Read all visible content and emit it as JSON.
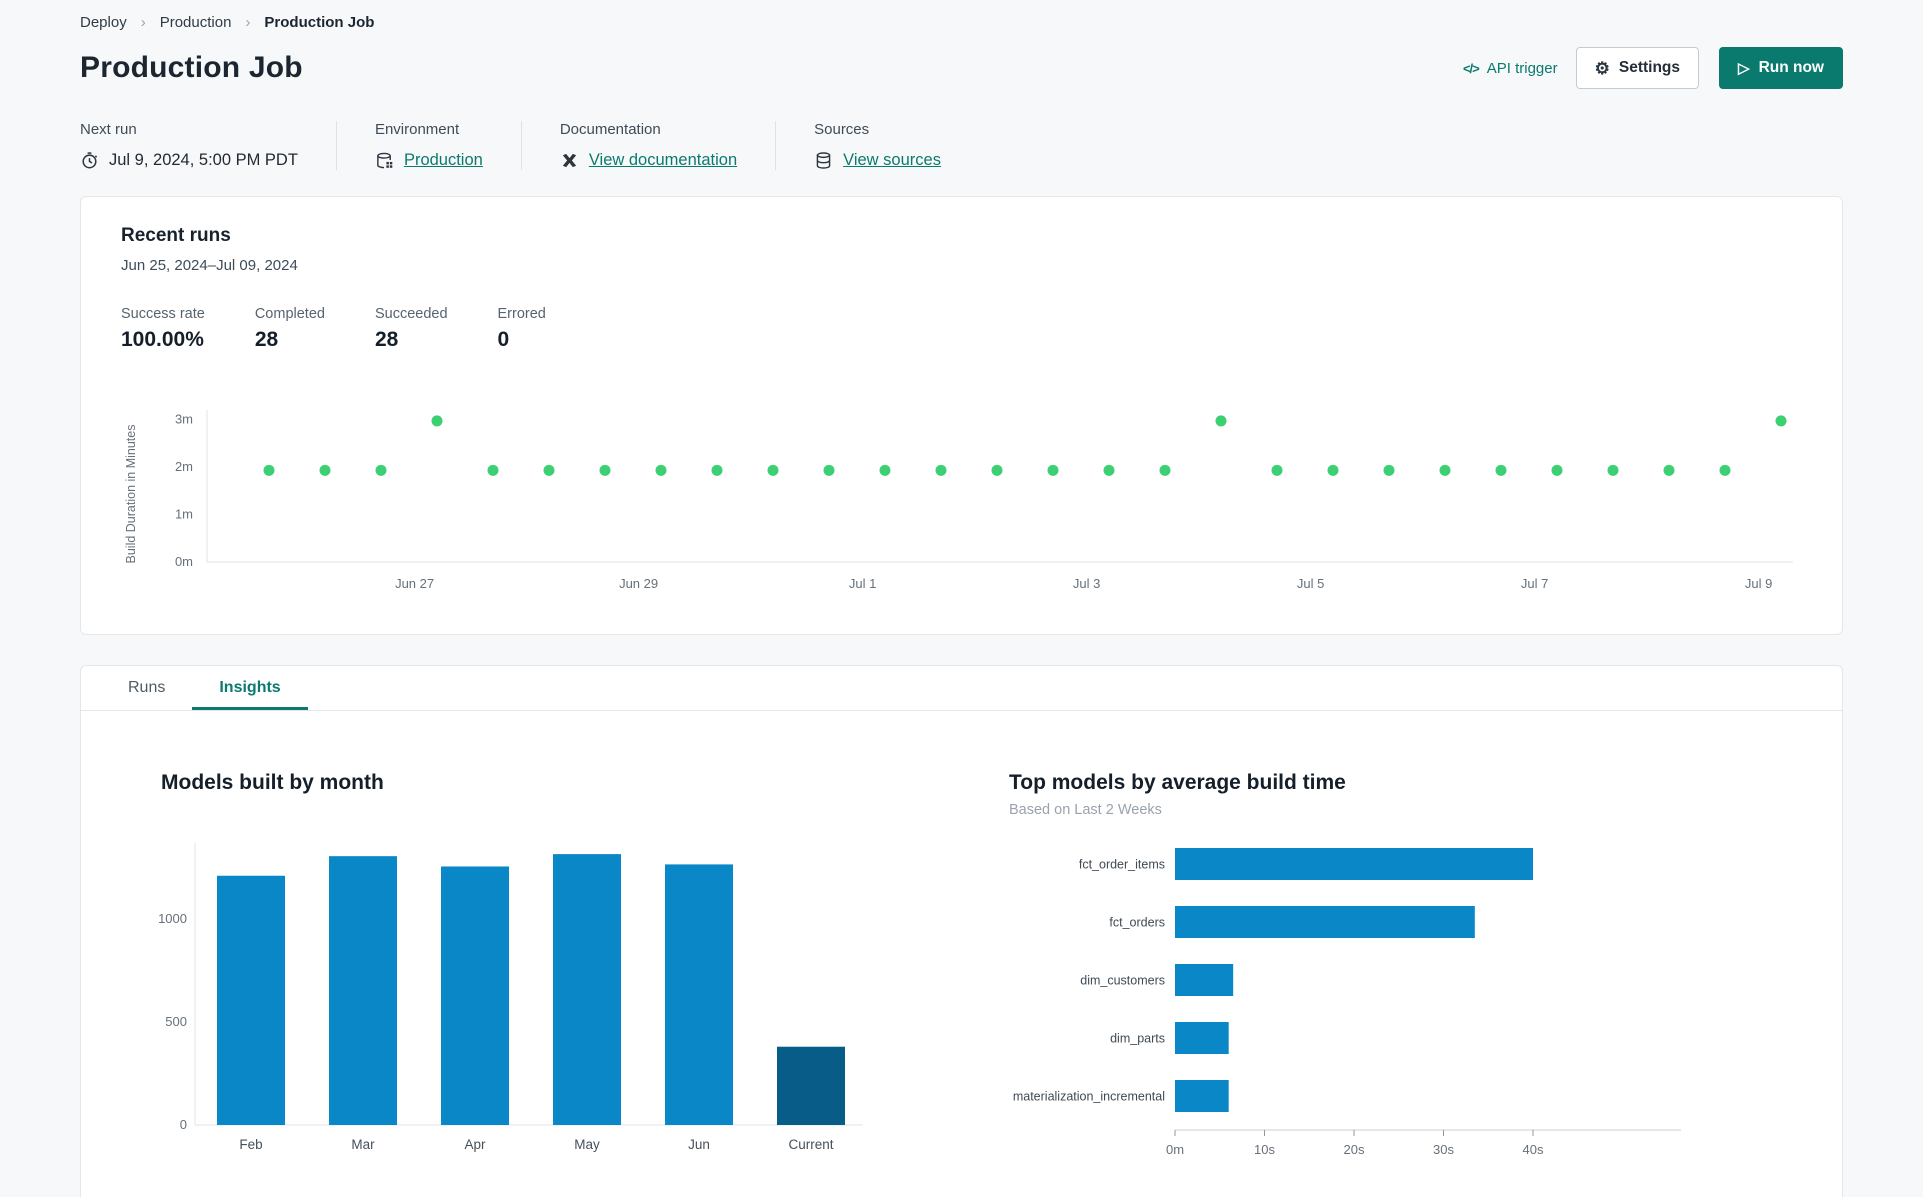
{
  "breadcrumb": {
    "items": [
      "Deploy",
      "Production",
      "Production Job"
    ],
    "separator": "›"
  },
  "header": {
    "title": "Production Job",
    "api_trigger": {
      "label": "API trigger",
      "icon_glyph": "</>"
    },
    "settings": {
      "label": "Settings",
      "icon_glyph": "⚙"
    },
    "run_now": {
      "label": "Run now",
      "icon_glyph": "▷"
    }
  },
  "meta": {
    "next_run": {
      "label": "Next run",
      "value": "Jul 9, 2024, 5:00 PM PDT"
    },
    "environment": {
      "label": "Environment",
      "value": "Production"
    },
    "documentation": {
      "label": "Documentation",
      "value": "View documentation"
    },
    "sources": {
      "label": "Sources",
      "value": "View sources"
    }
  },
  "recent_runs": {
    "title": "Recent runs",
    "date_range": "Jun 25, 2024–Jul 09, 2024",
    "stats": [
      {
        "label": "Success rate",
        "value": "100.00%"
      },
      {
        "label": "Completed",
        "value": "28"
      },
      {
        "label": "Succeeded",
        "value": "28"
      },
      {
        "label": "Errored",
        "value": "0"
      }
    ]
  },
  "tabs": [
    {
      "label": "Runs",
      "active": false
    },
    {
      "label": "Insights",
      "active": true
    }
  ],
  "colors": {
    "accent_teal": "#0b7a6e",
    "scatter_green": "#3ccf74",
    "bar_blue": "#0a87c7",
    "bar_dark_blue": "#075d87",
    "axis_line": "#dfe3e7",
    "axis_text": "#66707b",
    "page_bg": "#f7f8f9",
    "card_border": "#e4e7ea"
  },
  "chart_data": [
    {
      "id": "build-duration-scatter",
      "type": "scatter",
      "ylabel": "Build Duration in Minutes",
      "yticks": [
        {
          "label": "0m",
          "value": 0
        },
        {
          "label": "1m",
          "value": 1
        },
        {
          "label": "2m",
          "value": 2
        },
        {
          "label": "3m",
          "value": 3
        }
      ],
      "ylim": [
        0,
        3.3
      ],
      "xticks": [
        {
          "label": "Jun 27",
          "index": 2.6
        },
        {
          "label": "Jun 29",
          "index": 6.6
        },
        {
          "label": "Jul 1",
          "index": 10.6
        },
        {
          "label": "Jul 3",
          "index": 14.6
        },
        {
          "label": "Jul 5",
          "index": 18.6
        },
        {
          "label": "Jul 7",
          "index": 22.6
        },
        {
          "label": "Jul 9",
          "index": 26.6
        }
      ],
      "points": [
        {
          "run": 1,
          "minutes": 1.93
        },
        {
          "run": 2,
          "minutes": 1.93
        },
        {
          "run": 3,
          "minutes": 1.93
        },
        {
          "run": 4,
          "minutes": 2.97
        },
        {
          "run": 5,
          "minutes": 1.93
        },
        {
          "run": 6,
          "minutes": 1.93
        },
        {
          "run": 7,
          "minutes": 1.93
        },
        {
          "run": 8,
          "minutes": 1.93
        },
        {
          "run": 9,
          "minutes": 1.93
        },
        {
          "run": 10,
          "minutes": 1.93
        },
        {
          "run": 11,
          "minutes": 1.93
        },
        {
          "run": 12,
          "minutes": 1.93
        },
        {
          "run": 13,
          "minutes": 1.93
        },
        {
          "run": 14,
          "minutes": 1.93
        },
        {
          "run": 15,
          "minutes": 1.93
        },
        {
          "run": 16,
          "minutes": 1.93
        },
        {
          "run": 17,
          "minutes": 1.93
        },
        {
          "run": 18,
          "minutes": 2.97
        },
        {
          "run": 19,
          "minutes": 1.93
        },
        {
          "run": 20,
          "minutes": 1.93
        },
        {
          "run": 21,
          "minutes": 1.93
        },
        {
          "run": 22,
          "minutes": 1.93
        },
        {
          "run": 23,
          "minutes": 1.93
        },
        {
          "run": 24,
          "minutes": 1.93
        },
        {
          "run": 25,
          "minutes": 1.93
        },
        {
          "run": 26,
          "minutes": 1.93
        },
        {
          "run": 27,
          "minutes": 1.93
        },
        {
          "run": 28,
          "minutes": 2.97
        }
      ]
    },
    {
      "id": "models-built-by-month",
      "type": "bar",
      "title": "Models built by month",
      "categories": [
        "Feb",
        "Mar",
        "Apr",
        "May",
        "Jun",
        "Current"
      ],
      "values": [
        1210,
        1305,
        1255,
        1315,
        1265,
        380
      ],
      "bar_colors": [
        "#0a87c7",
        "#0a87c7",
        "#0a87c7",
        "#0a87c7",
        "#0a87c7",
        "#075d87"
      ],
      "yticks": [
        0,
        500,
        1000
      ],
      "ylim": [
        0,
        1400
      ],
      "grid": false,
      "legend": "none"
    },
    {
      "id": "top-models-by-build-time",
      "type": "bar-horizontal",
      "title": "Top models by average build time",
      "subtitle": "Based on Last 2 Weeks",
      "categories": [
        "fct_order_items",
        "fct_orders",
        "dim_customers",
        "dim_parts",
        "materialization_incremental"
      ],
      "values_seconds": [
        40,
        33.5,
        6.5,
        6,
        6
      ],
      "xticks": [
        {
          "label": "0m",
          "value": 0
        },
        {
          "label": "10s",
          "value": 10
        },
        {
          "label": "20s",
          "value": 20
        },
        {
          "label": "30s",
          "value": 30
        },
        {
          "label": "40s",
          "value": 40
        }
      ],
      "xlim": [
        0,
        45
      ],
      "grid": false,
      "legend": "none"
    }
  ]
}
